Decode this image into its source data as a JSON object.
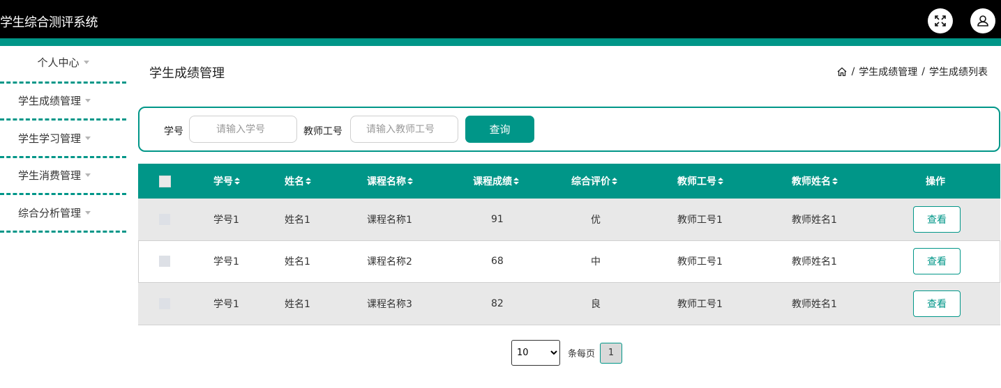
{
  "app": {
    "title": "学生综合测评系统"
  },
  "colors": {
    "accent": "#009688",
    "topbar": "#000000"
  },
  "header_icons": [
    "fullscreen-icon",
    "user-icon"
  ],
  "sidebar": {
    "items": [
      {
        "label": "个人中心"
      },
      {
        "label": "学生成绩管理"
      },
      {
        "label": "学生学习管理"
      },
      {
        "label": "学生消费管理"
      },
      {
        "label": "综合分析管理"
      }
    ]
  },
  "page": {
    "title": "学生成绩管理",
    "breadcrumb": [
      "学生成绩管理",
      "学生成绩列表"
    ]
  },
  "search": {
    "student_label": "学号",
    "student_placeholder": "请输入学号",
    "teacher_label": "教师工号",
    "teacher_placeholder": "请输入教师工号",
    "query_button": "查询"
  },
  "table": {
    "columns": [
      "学号",
      "姓名",
      "课程名称",
      "课程成绩",
      "综合评价",
      "教师工号",
      "教师姓名",
      "操作"
    ],
    "rows": [
      {
        "student_id": "学号1",
        "name": "姓名1",
        "course": "课程名称1",
        "score": "91",
        "rating": "优",
        "teacher_id": "教师工号1",
        "teacher_name": "教师姓名1",
        "action": "查看"
      },
      {
        "student_id": "学号1",
        "name": "姓名1",
        "course": "课程名称2",
        "score": "68",
        "rating": "中",
        "teacher_id": "教师工号1",
        "teacher_name": "教师姓名1",
        "action": "查看"
      },
      {
        "student_id": "学号1",
        "name": "姓名1",
        "course": "课程名称3",
        "score": "82",
        "rating": "良",
        "teacher_id": "教师工号1",
        "teacher_name": "教师姓名1",
        "action": "查看"
      }
    ]
  },
  "pagination": {
    "page_size": "10",
    "per_page_label": "条每页",
    "current_page": "1"
  }
}
